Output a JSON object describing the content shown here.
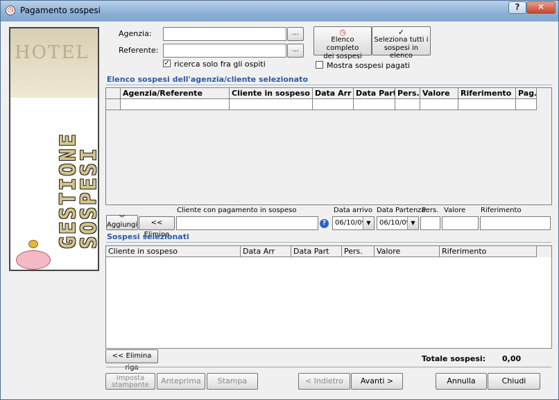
{
  "window": {
    "title": "Pagamento sospesi",
    "help": "?",
    "close": "✕"
  },
  "banner": {
    "hotel": "HOTEL",
    "line1": "GESTIONE",
    "line2": "SOSPESI"
  },
  "search": {
    "agenzia_label": "Agenzia:",
    "referente_label": "Referente:",
    "browse": "...",
    "ospiti_label": "ricerca solo fra gli ospiti",
    "ospiti_checked": true,
    "elenco_line1": "Elenco completo",
    "elenco_line2": "dei sospesi",
    "seleziona_line1": "Seleziona tutti i",
    "seleziona_line2": "sospesi in elenco",
    "mostra_label": "Mostra sospesi pagati"
  },
  "list_section": {
    "title": "Elenco sospesi dell'agenzia/cliente selezionato",
    "columns": [
      "Agenzia/Referente",
      "Cliente in sospeso",
      "Data Arr",
      "Data Part",
      "Pers.",
      "Valore",
      "Riferimento",
      "Pag."
    ]
  },
  "entry": {
    "aggiungi": "Aggiungi",
    "elimina": "<< Elimina",
    "cliente_label": "Cliente con pagamento in sospeso",
    "data_arrivo_label": "Data arrivo",
    "data_partenza_label": "Data Partenza",
    "pers_label": "Pers.",
    "valore_label": "Valore",
    "riferimento_label": "Riferimento",
    "data_arrivo": "06/10/09",
    "data_partenza": "06/10/09"
  },
  "selected_section": {
    "title": "Sospesi selezionati",
    "columns": [
      "Cliente in sospeso",
      "Data Arr",
      "Data Part",
      "Pers.",
      "Valore",
      "Riferimento"
    ],
    "elimina_riga": "<< Elimina riga",
    "totale_label": "Totale sospesi:",
    "totale_value": "0,00"
  },
  "footer": {
    "imposta_line1": "Imposta",
    "imposta_line2": "stampante",
    "anteprima": "Anteprima",
    "stampa": "Stampa",
    "indietro": "< Indietro",
    "avanti": "Avanti >",
    "annulla": "Annulla",
    "chiudi": "Chiudi"
  }
}
